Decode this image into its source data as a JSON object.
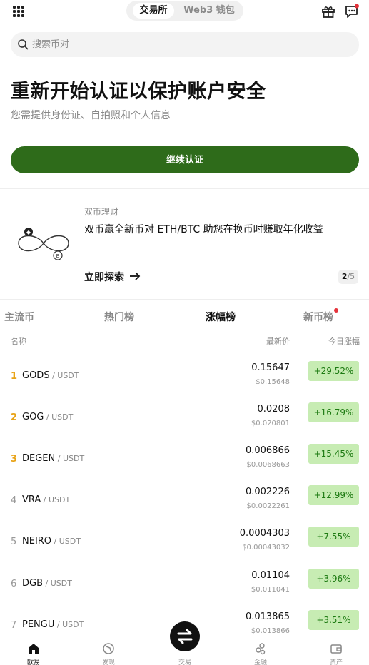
{
  "header": {
    "tab_exchange": "交易所",
    "tab_web3": "Web3 钱包"
  },
  "search": {
    "placeholder": "搜索币对"
  },
  "verify": {
    "title": "重新开始认证以保护账户安全",
    "subtitle": "您需提供身份证、自拍照和个人信息",
    "button": "继续认证"
  },
  "promo": {
    "tag": "双币理财",
    "title": "双币赢全新币对 ETH/BTC 助您在换币时赚取年化收益",
    "link": "立即探索",
    "page_current": "2",
    "page_total": "/5"
  },
  "market_tabs": [
    "主流币",
    "热门榜",
    "涨幅榜",
    "新币榜"
  ],
  "columns": {
    "name": "名称",
    "price": "最新价",
    "change": "今日涨幅"
  },
  "rows": [
    {
      "rank": "1",
      "base": "GODS",
      "quote": " / USDT",
      "price": "0.15647",
      "usd": "$0.15648",
      "change": "+29.52%"
    },
    {
      "rank": "2",
      "base": "GOG",
      "quote": " / USDT",
      "price": "0.0208",
      "usd": "$0.020801",
      "change": "+16.79%"
    },
    {
      "rank": "3",
      "base": "DEGEN",
      "quote": " / USDT",
      "price": "0.006866",
      "usd": "$0.0068663",
      "change": "+15.45%"
    },
    {
      "rank": "4",
      "base": "VRA",
      "quote": " / USDT",
      "price": "0.002226",
      "usd": "$0.0022261",
      "change": "+12.99%"
    },
    {
      "rank": "5",
      "base": "NEIRO",
      "quote": " / USDT",
      "price": "0.0004303",
      "usd": "$0.00043032",
      "change": "+7.55%"
    },
    {
      "rank": "6",
      "base": "DGB",
      "quote": " / USDT",
      "price": "0.01104",
      "usd": "$0.011041",
      "change": "+3.96%"
    },
    {
      "rank": "7",
      "base": "PENGU",
      "quote": " / USDT",
      "price": "0.013865",
      "usd": "$0.013866",
      "change": "+3.51%"
    }
  ],
  "nav": {
    "home": "欧易",
    "discover": "发现",
    "trade": "交易",
    "finance": "金融",
    "assets": "资产"
  },
  "colors": {
    "accent": "#2e6b1a",
    "gain_bg": "#c7ecb3",
    "gain_text": "#1d7a12",
    "rank_top": "#e8a317"
  }
}
